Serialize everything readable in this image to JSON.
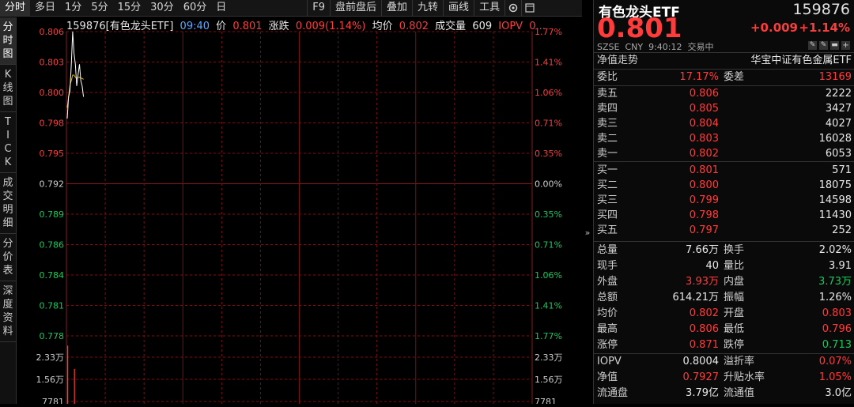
{
  "toolbar": {
    "items": [
      "分时",
      "多日",
      "1分",
      "5分",
      "15分",
      "30分",
      "60分",
      "日",
      "F9",
      "盘前盘后",
      "叠加",
      "九转",
      "画线",
      "工具"
    ],
    "icons": [
      "gear-icon",
      "window-icon"
    ]
  },
  "left_tabs": [
    "分时图",
    "K线图",
    "TICK",
    "成交明细",
    "分价表",
    "深度资料"
  ],
  "info_bar": {
    "name": "159876[有色龙头ETF]",
    "time": "09:40",
    "price_label": "价",
    "price": "0.801",
    "change_label": "涨跌",
    "change": "0.009(1.14%)",
    "avg_label": "均价",
    "avg": "0.802",
    "volume_label": "成交量",
    "volume": "609",
    "iopv_label": "IOPV",
    "iopv": "0..."
  },
  "chart_data": {
    "type": "line",
    "price_axis": [
      "0.806",
      "0.803",
      "0.800",
      "0.798",
      "0.795",
      "0.792",
      "0.789",
      "0.786",
      "0.784",
      "0.781",
      "0.778"
    ],
    "pct_axis": [
      "1.77%",
      "1.41%",
      "1.06%",
      "0.71%",
      "0.35%",
      "0.00%",
      "0.35%",
      "0.71%",
      "1.06%",
      "1.41%",
      "1.77%"
    ],
    "prev_close": 0.792,
    "ylim": [
      0.778,
      0.806
    ],
    "volume_axis": [
      "2.33万",
      "1.56万",
      "7781"
    ],
    "price_series": [
      0.798,
      0.8,
      0.8005,
      0.803,
      0.806,
      0.804,
      0.803,
      0.801,
      0.802,
      0.803,
      0.8015,
      0.801,
      0.8
    ],
    "avg_series": [
      0.799,
      0.8,
      0.801,
      0.8015,
      0.802,
      0.802,
      0.8018,
      0.8017,
      0.8018,
      0.8018,
      0.8017,
      0.8017,
      0.8016
    ],
    "volume_series": [
      30000,
      0,
      0,
      0,
      0,
      18000
    ]
  },
  "quote": {
    "name": "有色龙头ETF",
    "code": "159876",
    "price": "0.801",
    "change": "+0.009",
    "change_pct": "+1.14%",
    "market": "SZSE",
    "currency": "CNY",
    "time": "9:40:12",
    "status": "交易中",
    "nav_trend": "净值走势",
    "index_name": "华宝中证有色金属ETF"
  },
  "order_book": {
    "ratio_label": "委比",
    "ratio": "17.17%",
    "diff_label": "委差",
    "diff": "13169",
    "asks": [
      {
        "label": "卖五",
        "price": "0.806",
        "vol": "2222",
        "cls": "up"
      },
      {
        "label": "卖四",
        "price": "0.805",
        "vol": "3427",
        "cls": "up"
      },
      {
        "label": "卖三",
        "price": "0.804",
        "vol": "4027",
        "cls": "up"
      },
      {
        "label": "卖二",
        "price": "0.803",
        "vol": "16028",
        "cls": "up"
      },
      {
        "label": "卖一",
        "price": "0.802",
        "vol": "6053",
        "cls": "up"
      }
    ],
    "bids": [
      {
        "label": "买一",
        "price": "0.801",
        "vol": "571",
        "cls": "up"
      },
      {
        "label": "买二",
        "price": "0.800",
        "vol": "18075",
        "cls": "up"
      },
      {
        "label": "买三",
        "price": "0.799",
        "vol": "14598",
        "cls": "up"
      },
      {
        "label": "买四",
        "price": "0.798",
        "vol": "11430",
        "cls": "up"
      },
      {
        "label": "买五",
        "price": "0.797",
        "vol": "252",
        "cls": "up"
      }
    ]
  },
  "stats": [
    {
      "l1": "总量",
      "v1": "7.66万",
      "c1": "white",
      "l2": "换手",
      "v2": "2.02%",
      "c2": "white"
    },
    {
      "l1": "现手",
      "v1": "40",
      "c1": "white",
      "l2": "量比",
      "v2": "3.91",
      "c2": "white"
    },
    {
      "l1": "外盘",
      "v1": "3.93万",
      "c1": "up",
      "l2": "内盘",
      "v2": "3.73万",
      "c2": "down"
    },
    {
      "l1": "总额",
      "v1": "614.21万",
      "c1": "white",
      "l2": "振幅",
      "v2": "1.26%",
      "c2": "white"
    },
    {
      "l1": "均价",
      "v1": "0.802",
      "c1": "up",
      "l2": "开盘",
      "v2": "0.803",
      "c2": "up"
    },
    {
      "l1": "最高",
      "v1": "0.806",
      "c1": "up",
      "l2": "最低",
      "v2": "0.796",
      "c2": "up"
    },
    {
      "l1": "涨停",
      "v1": "0.871",
      "c1": "up",
      "l2": "跌停",
      "v2": "0.713",
      "c2": "down"
    }
  ],
  "extra": [
    {
      "l1": "IOPV",
      "v1": "0.8004",
      "c1": "white",
      "l2": "溢折率",
      "v2": "0.07%",
      "c2": "up"
    },
    {
      "l1": "净值",
      "v1": "0.7927",
      "c1": "up",
      "l2": "升贴水率",
      "v2": "1.05%",
      "c2": "up"
    },
    {
      "l1": "流通盘",
      "v1": "3.79亿",
      "c1": "white",
      "l2": "流通值",
      "v2": "3.0亿",
      "c2": "white"
    }
  ],
  "colors": {
    "up": "#ff3b3b",
    "down": "#19c95b",
    "grid": "#7a1010"
  }
}
